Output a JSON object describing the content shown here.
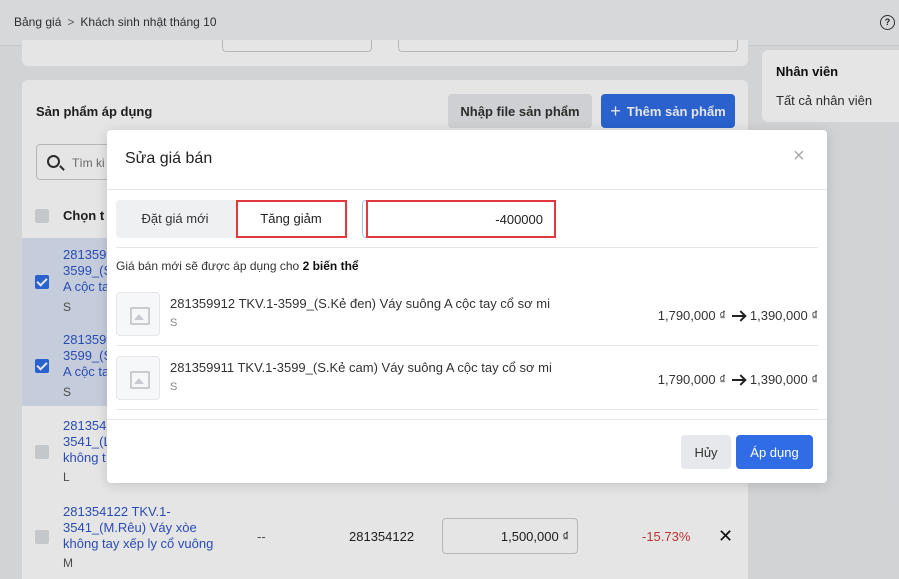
{
  "breadcrumb": {
    "parent": "Bảng giá",
    "separator": ">",
    "current": "Khách sinh nhật tháng 10"
  },
  "side_panel": {
    "title": "Nhân viên",
    "value": "Tất cả nhân viên"
  },
  "products_section": {
    "title": "Sản phẩm áp dụng",
    "import_button": "Nhập file sản phẩm",
    "add_button": "Thêm sản phẩm",
    "add_icon": "+",
    "search_placeholder": "Tìm ki",
    "header_select": "Chọn t"
  },
  "product_rows": [
    {
      "name": "281359\n3599_(S\nA cộc ta",
      "variant": "S",
      "selected": true
    },
    {
      "name": "281359\n3599_(S\nA cộc ta",
      "variant": "S",
      "selected": true
    },
    {
      "name": "281354\n3541_(L\nkhông t",
      "variant": "L",
      "selected": false
    },
    {
      "name": "281354122 TKV.1-\n3541_(M.Rêu) Váy xòe\nkhông tay xếp ly cổ vuông",
      "variant": "M",
      "selected": false,
      "dash": "--",
      "code": "281354122",
      "price": "1,500,000 ₫",
      "percent": "-15.73%",
      "remove": "✕"
    }
  ],
  "modal": {
    "title": "Sửa giá bán",
    "close": "×",
    "tabs": [
      "Đặt giá mới",
      "Tăng giảm"
    ],
    "active_tab": "Tăng giảm",
    "amount_value": "-400000",
    "note_prefix": "Giá bán mới sẽ được áp dụng cho",
    "note_count": "2 biến thể",
    "variants": [
      {
        "name": "281359912 TKV.1-3599_(S.Kẻ đen) Váy suông A cộc tay cổ sơ mi",
        "size": "S",
        "old_price": "1,790,000 ₫",
        "new_price": "1,390,000 ₫"
      },
      {
        "name": "281359911 TKV.1-3599_(S.Kẻ cam) Váy suông A cộc tay cổ sơ mi",
        "size": "S",
        "old_price": "1,790,000 ₫",
        "new_price": "1,390,000 ₫"
      }
    ],
    "cancel_button": "Hủy",
    "apply_button": "Áp dụng"
  },
  "colors": {
    "primary": "#2f6ce5",
    "highlight": "#e0393e",
    "negative": "#d33a3a",
    "link": "#2f55c8"
  }
}
